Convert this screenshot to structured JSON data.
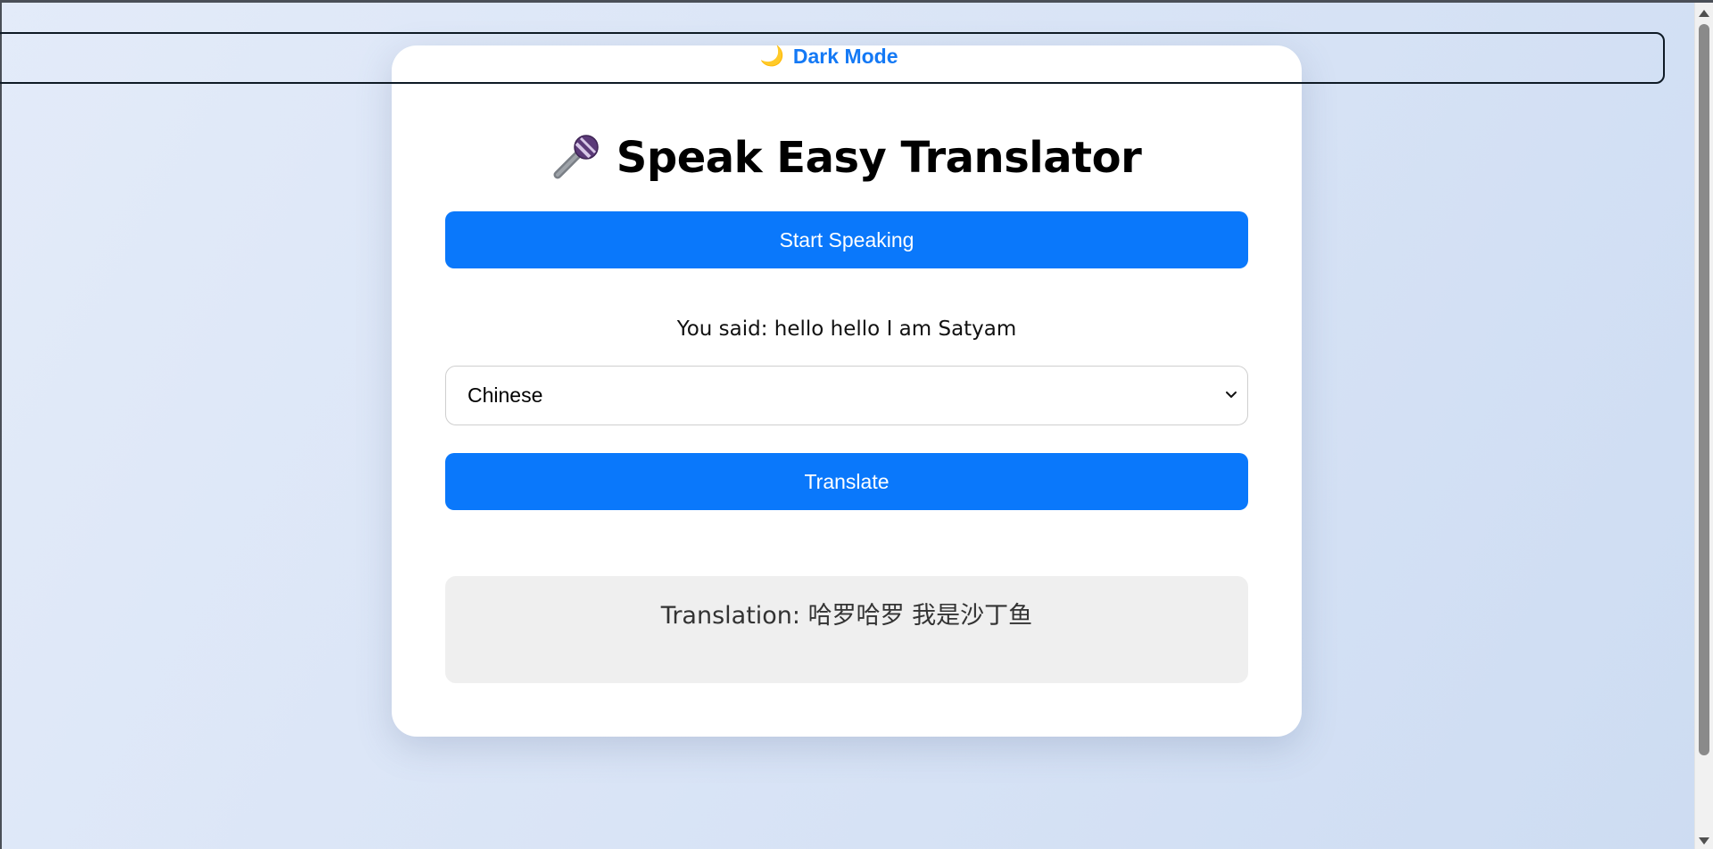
{
  "dark_mode": {
    "icon": "moon-icon",
    "label": "Dark Mode"
  },
  "title": {
    "icon": "microphone-icon",
    "text": "Speak Easy Translator"
  },
  "start_button": {
    "label": "Start Speaking"
  },
  "recognized": {
    "text": "You said: hello hello I am Satyam"
  },
  "language_select": {
    "selected": "Chinese"
  },
  "translate_button": {
    "label": "Translate"
  },
  "result": {
    "text": "Translation: 哈罗哈罗 我是沙丁鱼"
  },
  "colors": {
    "accent": "#0a78fb",
    "dark_mode_text": "#1479f5",
    "result_bg": "#efefef",
    "background_start": "#e3ebf9",
    "background_end": "#cddcf2"
  }
}
